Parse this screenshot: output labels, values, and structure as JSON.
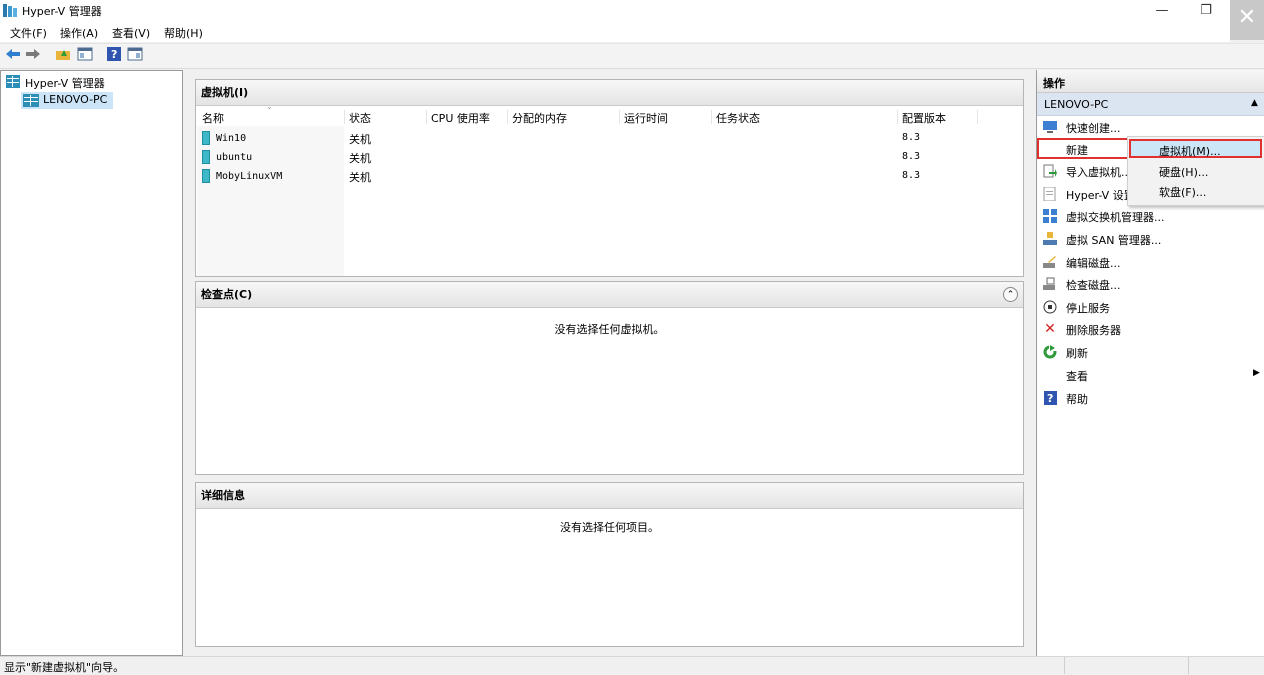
{
  "window": {
    "title": "Hyper-V 管理器",
    "minimize": "—",
    "restore": "❐",
    "close": "✕"
  },
  "menu": [
    "文件(F)",
    "操作(A)",
    "查看(V)",
    "帮助(H)"
  ],
  "toolbar": {
    "icons": [
      "back-arrow-icon",
      "forward-arrow-icon",
      "up-folder-icon",
      "show-hide-console-tree-icon",
      "help-icon",
      "show-hide-action-pane-icon"
    ]
  },
  "tree": {
    "root": "Hyper-V 管理器",
    "child": "LENOVO-PC"
  },
  "vms": {
    "header": "虚拟机(I)",
    "columns": [
      "名称",
      "状态",
      "CPU 使用率",
      "分配的内存",
      "运行时间",
      "任务状态",
      "配置版本"
    ],
    "rows": [
      {
        "name": "Win10",
        "state": "关机",
        "version": "8.3"
      },
      {
        "name": "ubuntu",
        "state": "关机",
        "version": "8.3"
      },
      {
        "name": "MobyLinuxVM",
        "state": "关机",
        "version": "8.3"
      }
    ]
  },
  "checkpoints": {
    "header": "检查点(C)",
    "empty": "没有选择任何虚拟机。",
    "collapse": "⌃"
  },
  "details": {
    "header": "详细信息",
    "empty": "没有选择任何项目。"
  },
  "actions": {
    "header": "操作",
    "section": "LENOVO-PC",
    "section_toggle": "▲",
    "items": [
      {
        "label": "快速创建...",
        "icon": "quick-create-icon"
      },
      {
        "label": "新建",
        "icon": ""
      },
      {
        "label": "导入虚拟机...",
        "icon": "import-vm-icon"
      },
      {
        "label": "Hyper-V 设置...",
        "icon": "hyperv-settings-icon"
      },
      {
        "label": "虚拟交换机管理器...",
        "icon": "virtual-switch-icon"
      },
      {
        "label": "虚拟 SAN 管理器...",
        "icon": "virtual-san-icon"
      },
      {
        "label": "编辑磁盘...",
        "icon": "edit-disk-icon"
      },
      {
        "label": "检查磁盘...",
        "icon": "inspect-disk-icon"
      },
      {
        "label": "停止服务",
        "icon": "stop-service-icon"
      },
      {
        "label": "删除服务器",
        "icon": "remove-server-icon"
      },
      {
        "label": "刷新",
        "icon": "refresh-icon"
      },
      {
        "label": "查看",
        "icon": ""
      },
      {
        "label": "帮助",
        "icon": "help-icon"
      }
    ],
    "view_arrow": "▶"
  },
  "submenu": {
    "items": [
      "虚拟机(M)...",
      "硬盘(H)...",
      "软盘(F)..."
    ],
    "highlighted": "虚拟机(M)..."
  },
  "status": {
    "text": "显示\"新建虚拟机\"向导。"
  },
  "colors": {
    "highlight_border": "#e03030",
    "selection_bg": "#cce4f7",
    "submenu_hover": "#cde6f7",
    "vm_icon": "#3cb8c8"
  }
}
